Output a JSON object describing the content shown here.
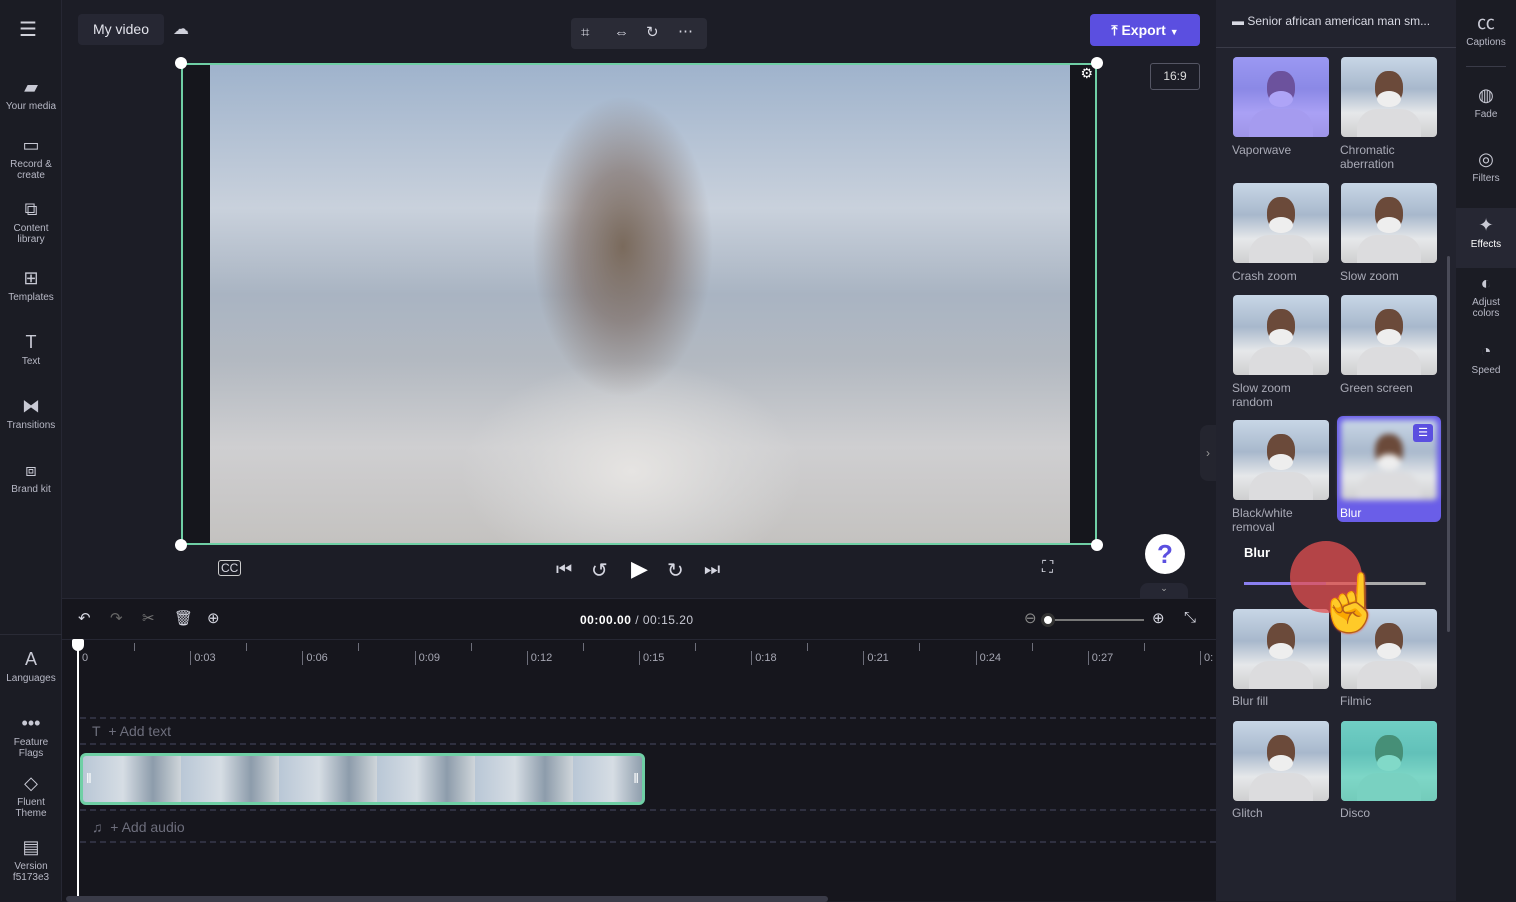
{
  "colors": {
    "accent": "#5b4fe0",
    "selection": "#6fcfa5",
    "blur_selected": "#6a5ee8"
  },
  "left_nav": [
    {
      "label": "Your media",
      "icon": "folder-icon"
    },
    {
      "label": "Record &\ncreate",
      "icon": "camera-icon"
    },
    {
      "label": "Content\nlibrary",
      "icon": "library-icon"
    },
    {
      "label": "Templates",
      "icon": "templates-icon"
    },
    {
      "label": "Text",
      "icon": "text-icon"
    },
    {
      "label": "Transitions",
      "icon": "transitions-icon"
    },
    {
      "label": "Brand kit",
      "icon": "brand-kit-icon"
    }
  ],
  "left_nav_bottom": [
    {
      "label": "Languages",
      "icon": "languages-icon"
    },
    {
      "label": "Feature\nFlags",
      "icon": "more-icon"
    },
    {
      "label": "Fluent\nTheme",
      "icon": "paint-bucket-icon"
    },
    {
      "label": "Version\nf5173e3",
      "icon": "archive-icon"
    }
  ],
  "header": {
    "title": "My video",
    "export_label": "Export",
    "aspect_ratio": "16:9"
  },
  "player": {
    "current_time": "00:00.00",
    "total_time": "/ 00:15.20"
  },
  "timeline": {
    "ticks": [
      "0",
      "0:03",
      "0:06",
      "0:09",
      "0:12",
      "0:15",
      "0:18",
      "0:21",
      "0:24",
      "0:27",
      "0:"
    ],
    "add_text": "+ Add text",
    "add_audio": "+ Add audio"
  },
  "right_panel": {
    "clip_title": "Senior african american man sm...",
    "effects": [
      {
        "label": "Vaporwave"
      },
      {
        "label": "Chromatic\naberration"
      },
      {
        "label": "Crash zoom"
      },
      {
        "label": "Slow zoom"
      },
      {
        "label": "Slow zoom\nrandom"
      },
      {
        "label": "Green screen"
      },
      {
        "label": "Black/white\nremoval"
      },
      {
        "label": "Blur",
        "selected": true
      },
      {
        "label": "Blur fill"
      },
      {
        "label": "Filmic"
      },
      {
        "label": "Glitch"
      },
      {
        "label": "Disco"
      }
    ],
    "blur_label": "Blur",
    "blur_value_percent": 45
  },
  "rail": [
    {
      "label": "Captions",
      "icon": "captions-icon"
    },
    {
      "label": "Fade",
      "icon": "fade-icon"
    },
    {
      "label": "Filters",
      "icon": "filters-icon"
    },
    {
      "label": "Effects",
      "icon": "effects-wand-icon",
      "active": true
    },
    {
      "label": "Adjust\ncolors",
      "icon": "adjust-colors-icon"
    },
    {
      "label": "Speed",
      "icon": "speed-icon"
    }
  ]
}
